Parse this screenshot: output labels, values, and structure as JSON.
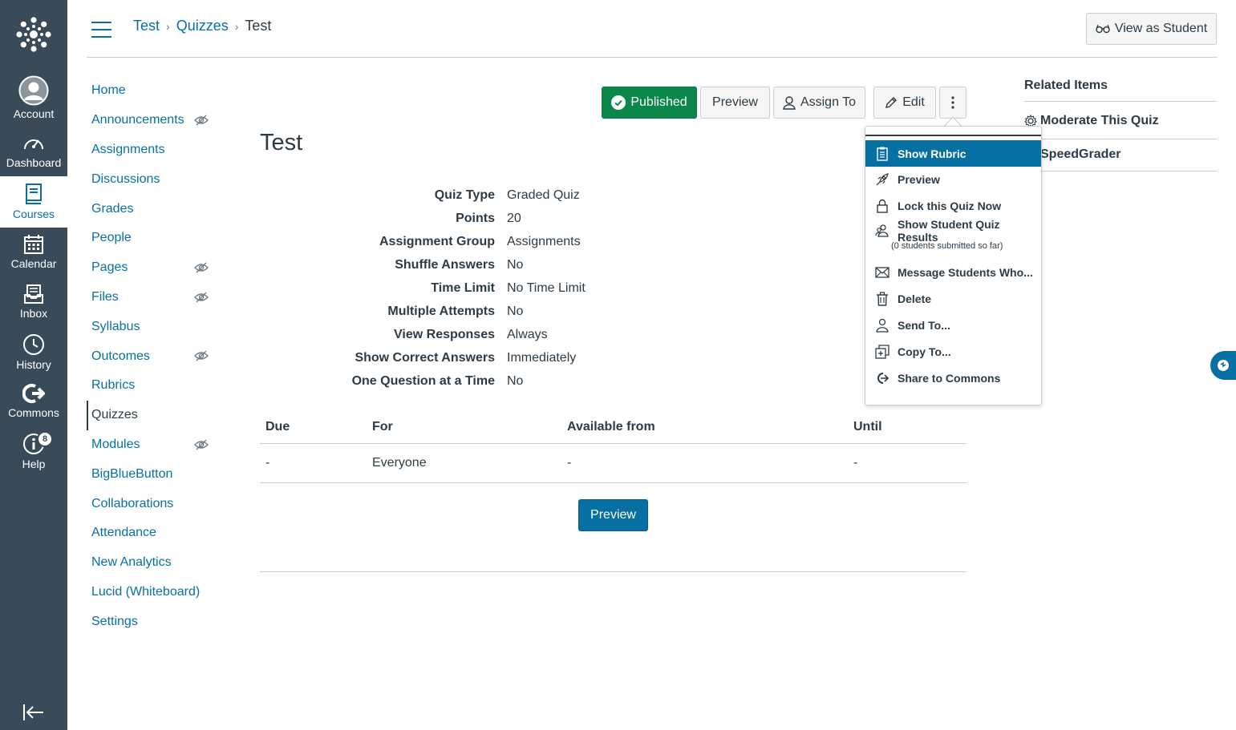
{
  "global_nav": {
    "items": [
      {
        "label": "Account",
        "icon": "user-avatar-icon"
      },
      {
        "label": "Dashboard",
        "icon": "dashboard-icon"
      },
      {
        "label": "Courses",
        "icon": "courses-icon"
      },
      {
        "label": "Calendar",
        "icon": "calendar-icon"
      },
      {
        "label": "Inbox",
        "icon": "inbox-icon"
      },
      {
        "label": "History",
        "icon": "clock-icon"
      },
      {
        "label": "Commons",
        "icon": "commons-icon"
      },
      {
        "label": "Help",
        "icon": "help-icon"
      }
    ],
    "help_badge": "8",
    "active": "Courses",
    "colors": {
      "bg": "#394b58",
      "active_text": "#0770a3"
    }
  },
  "header": {
    "breadcrumb": [
      "Test",
      "Quizzes",
      "Test"
    ],
    "view_as_student": "View as Student"
  },
  "course_nav": {
    "items": [
      {
        "label": "Home",
        "hidden": false
      },
      {
        "label": "Announcements",
        "hidden": true
      },
      {
        "label": "Assignments",
        "hidden": false
      },
      {
        "label": "Discussions",
        "hidden": false
      },
      {
        "label": "Grades",
        "hidden": false
      },
      {
        "label": "People",
        "hidden": false
      },
      {
        "label": "Pages",
        "hidden": true
      },
      {
        "label": "Files",
        "hidden": true
      },
      {
        "label": "Syllabus",
        "hidden": false
      },
      {
        "label": "Outcomes",
        "hidden": true
      },
      {
        "label": "Rubrics",
        "hidden": false
      },
      {
        "label": "Quizzes",
        "hidden": false,
        "active": true
      },
      {
        "label": "Modules",
        "hidden": true
      },
      {
        "label": "BigBlueButton",
        "hidden": false
      },
      {
        "label": "Collaborations",
        "hidden": false
      },
      {
        "label": "Attendance",
        "hidden": false
      },
      {
        "label": "New Analytics",
        "hidden": false
      },
      {
        "label": "Lucid (Whiteboard)",
        "hidden": false
      },
      {
        "label": "Settings",
        "hidden": false
      }
    ]
  },
  "toolbar": {
    "published": "Published",
    "preview": "Preview",
    "assign_to": "Assign To",
    "edit": "Edit",
    "colors": {
      "published": "#0b874b"
    }
  },
  "quiz": {
    "title": "Test",
    "details": [
      {
        "label": "Quiz Type",
        "value": "Graded Quiz"
      },
      {
        "label": "Points",
        "value": "20"
      },
      {
        "label": "Assignment Group",
        "value": "Assignments"
      },
      {
        "label": "Shuffle Answers",
        "value": "No"
      },
      {
        "label": "Time Limit",
        "value": "No Time Limit"
      },
      {
        "label": "Multiple Attempts",
        "value": "No"
      },
      {
        "label": "View Responses",
        "value": "Always"
      },
      {
        "label": "Show Correct Answers",
        "value": "Immediately"
      },
      {
        "label": "One Question at a Time",
        "value": "No"
      }
    ],
    "due_table": {
      "headers": [
        "Due",
        "For",
        "Available from",
        "Until"
      ],
      "rows": [
        [
          "-",
          "Everyone",
          "-",
          "-"
        ]
      ]
    },
    "preview_button": "Preview"
  },
  "related": {
    "title": "Related Items",
    "items": [
      "Moderate This Quiz",
      "SpeedGrader"
    ]
  },
  "menu": {
    "items": [
      {
        "label": "Show Rubric",
        "icon": "rubric-icon",
        "active": true
      },
      {
        "label": "Preview",
        "icon": "rocket-icon"
      },
      {
        "label": "Lock this Quiz Now",
        "icon": "lock-icon"
      },
      {
        "label": "Show Student Quiz Results",
        "icon": "students-icon",
        "sub": "(0 students submitted so far)"
      },
      {
        "label": "Message Students Who...",
        "icon": "envelope-icon"
      },
      {
        "label": "Delete",
        "icon": "trash-icon"
      },
      {
        "label": "Send To...",
        "icon": "user-send-icon"
      },
      {
        "label": "Copy To...",
        "icon": "copy-icon"
      },
      {
        "label": "Share to Commons",
        "icon": "commons-share-icon"
      }
    ]
  }
}
